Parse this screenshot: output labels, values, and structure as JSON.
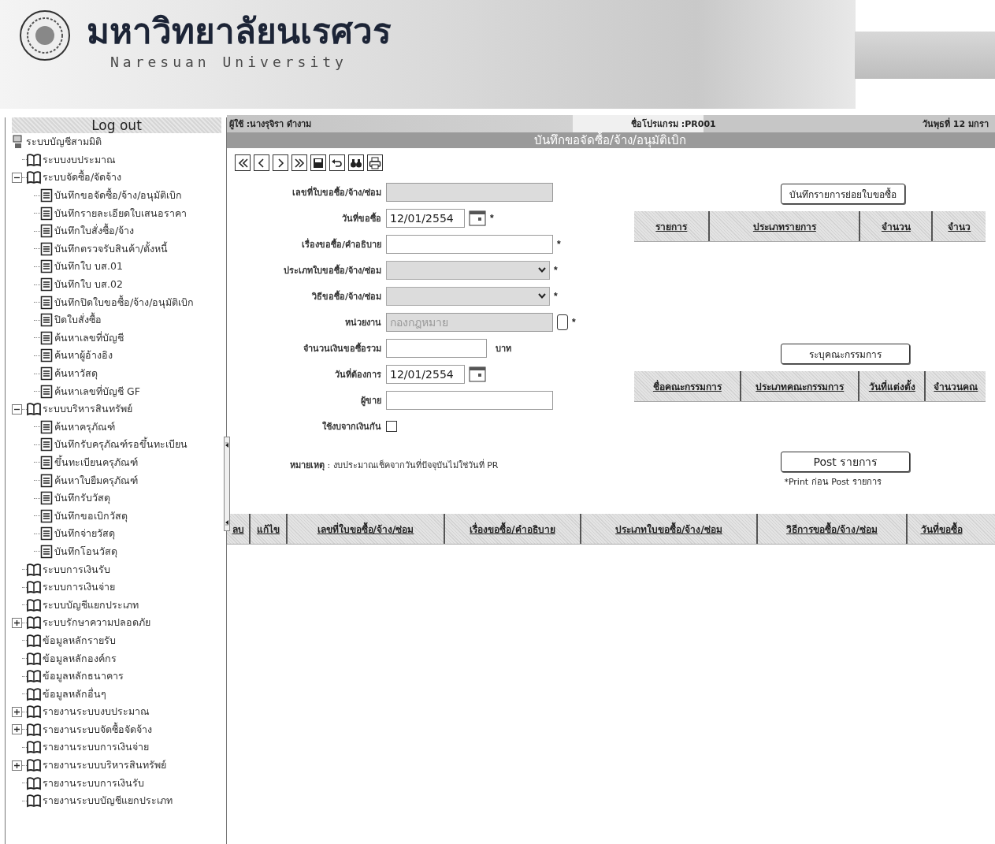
{
  "banner": {
    "name_th": "มหาวิทยาลัยนเรศวร",
    "name_en": "Naresuan University"
  },
  "sidebar": {
    "logout": "Log out",
    "tree": {
      "label": "ระบบบัญชีสามมิติ",
      "kind": "root",
      "children": [
        {
          "label": "ระบบงบประมาณ",
          "kind": "folder"
        },
        {
          "label": "ระบบจัดซื้อ/จัดจ้าง",
          "kind": "folder",
          "expanded": true,
          "children": [
            {
              "label": "บันทึกขอจัดซื้อ/จ้าง/อนุมัติเบิก",
              "kind": "page"
            },
            {
              "label": "บันทึกรายละเอียดใบเสนอราคา",
              "kind": "page"
            },
            {
              "label": "บันทึกใบสั่งซื้อ/จ้าง",
              "kind": "page"
            },
            {
              "label": "บันทึกตรวจรับสินค้า/ตั้งหนี้",
              "kind": "page"
            },
            {
              "label": "บันทึกใบ บส.01",
              "kind": "page"
            },
            {
              "label": "บันทึกใบ บส.02",
              "kind": "page"
            },
            {
              "label": "บันทึกปิดใบขอซื้อ/จ้าง/อนุมัติเบิก",
              "kind": "page"
            },
            {
              "label": "ปิดใบสั่งซื้อ",
              "kind": "page"
            },
            {
              "label": "ค้นหาเลขที่บัญชี",
              "kind": "page"
            },
            {
              "label": "ค้นหาผู้อ้างอิง",
              "kind": "page"
            },
            {
              "label": "ค้นหาวัสดุ",
              "kind": "page"
            },
            {
              "label": "ค้นหาเลขที่บัญชี GF",
              "kind": "page"
            }
          ]
        },
        {
          "label": "ระบบบริหารสินทรัพย์",
          "kind": "folder",
          "expanded": true,
          "children": [
            {
              "label": "ค้นหาครุภัณฑ์",
              "kind": "page"
            },
            {
              "label": "บันทึกรับครุภัณฑ์รอขึ้นทะเบียน",
              "kind": "page"
            },
            {
              "label": "ขึ้นทะเบียนครุภัณฑ์",
              "kind": "page"
            },
            {
              "label": "ค้นหาใบยืมครุภัณฑ์",
              "kind": "page"
            },
            {
              "label": "บันทึกรับวัสดุ",
              "kind": "page"
            },
            {
              "label": "บันทึกขอเบิกวัสดุ",
              "kind": "page"
            },
            {
              "label": "บันทึกจ่ายวัสดุ",
              "kind": "page"
            },
            {
              "label": "บันทึกโอนวัสดุ",
              "kind": "page"
            }
          ]
        },
        {
          "label": "ระบบการเงินรับ",
          "kind": "folder"
        },
        {
          "label": "ระบบการเงินจ่าย",
          "kind": "folder"
        },
        {
          "label": "ระบบบัญชีแยกประเภท",
          "kind": "folder"
        },
        {
          "label": "ระบบรักษาความปลอดภัย",
          "kind": "folder",
          "expanded": false
        },
        {
          "label": "ข้อมูลหลักรายรับ",
          "kind": "folder"
        },
        {
          "label": "ข้อมูลหลักองค์กร",
          "kind": "folder"
        },
        {
          "label": "ข้อมูลหลักธนาคาร",
          "kind": "folder"
        },
        {
          "label": "ข้อมูลหลักอื่นๆ",
          "kind": "folder"
        },
        {
          "label": "รายงานระบบงบประมาณ",
          "kind": "folder",
          "expanded": false
        },
        {
          "label": "รายงานระบบจัดซื้อจัดจ้าง",
          "kind": "folder",
          "expanded": false
        },
        {
          "label": "รายงานระบบการเงินจ่าย",
          "kind": "folder"
        },
        {
          "label": "รายงานระบบบริหารสินทรัพย์",
          "kind": "folder",
          "expanded": false
        },
        {
          "label": "รายงานระบบการเงินรับ",
          "kind": "folder"
        },
        {
          "label": "รายงานระบบบัญชีแยกประเภท",
          "kind": "folder"
        }
      ]
    }
  },
  "info_bar": {
    "user": "ผู้ใช้ :นางรุจิรา ดำงาม",
    "program": "ชื่อโปรแกรม :PR001",
    "date": "วันพุธที่ 12 มกรา"
  },
  "title": "บันทึกขอจัดซื้อ/จ้าง/อนุมัติเบิก",
  "toolbar": [
    {
      "kind": "first"
    },
    {
      "kind": "prev"
    },
    {
      "kind": "next"
    },
    {
      "kind": "last"
    },
    {
      "kind": "save"
    },
    {
      "kind": "undo"
    },
    {
      "kind": "find"
    },
    {
      "kind": "print"
    }
  ],
  "form": {
    "fields": [
      {
        "label": "เลขที่ใบขอซื้อ/จ้าง/ซ่อม",
        "kind": "text",
        "disabled": true
      },
      {
        "label": "วันที่ขอซื้อ",
        "kind": "date",
        "value": "12/01/2554",
        "disabled": false,
        "required_mark": "*"
      },
      {
        "label": "เรื่องขอซื้อ/คำอธิบาย",
        "kind": "text",
        "disabled": false,
        "required_mark": "*"
      },
      {
        "label": "ประเภทใบขอซื้อ/จ้าง/ซ่อม",
        "kind": "select",
        "disabled": true,
        "required_mark": "*"
      },
      {
        "label": "วิธีขอซื้อ/จ้าง/ซ่อม",
        "kind": "select",
        "disabled": true,
        "required_mark": "*"
      },
      {
        "label": "หน่วยงาน",
        "kind": "lookup",
        "value": "กองกฎหมาย",
        "disabled": true,
        "required_mark": "*"
      },
      {
        "label": "จำนวนเงินขอซื้อรวม",
        "kind": "amount",
        "unit": "บาท",
        "disabled": false
      },
      {
        "label": "วันที่ต้องการ",
        "kind": "date",
        "value": "12/01/2554",
        "disabled": false
      },
      {
        "label": "ผู้ขาย",
        "kind": "text",
        "disabled": false
      },
      {
        "label": "ใช้งบจากเงินกัน",
        "kind": "checkbox",
        "checked": false
      }
    ],
    "note": "**หมายเหตุ** : งบประมาณเช็คจากวันที่ปัจจุบันไม่ใช่วันที่ PR"
  },
  "items_panel": {
    "button": "บันทึกรายการย่อยใบขอซื้อ",
    "columns": [
      "รายการ",
      "ประเภทรายการ",
      "จำนวน",
      "จำนว"
    ]
  },
  "committee_panel": {
    "button": "ระบุคณะกรรมการ",
    "columns": [
      "ชื่อคณะกรรมการ",
      "ประเภทคณะกรรมการ",
      "วันที่แต่งตั้ง",
      "จำนวนคณ"
    ]
  },
  "post": {
    "button": "Post รายการ",
    "note": "*Print ก่อน Post รายการ"
  },
  "list_table": {
    "columns": [
      "ลบ",
      "แก้ไข",
      "เลขที่ใบขอซื้อ/จ้าง/ซ่อม",
      "เรื่องขอซื้อ/คำอธิบาย",
      "ประเภทใบขอซื้อ/จ้าง/ซ่อม",
      "วิธีการขอซื้อ/จ้าง/ซ่อม",
      "วันที่ขอซื้อ"
    ]
  }
}
